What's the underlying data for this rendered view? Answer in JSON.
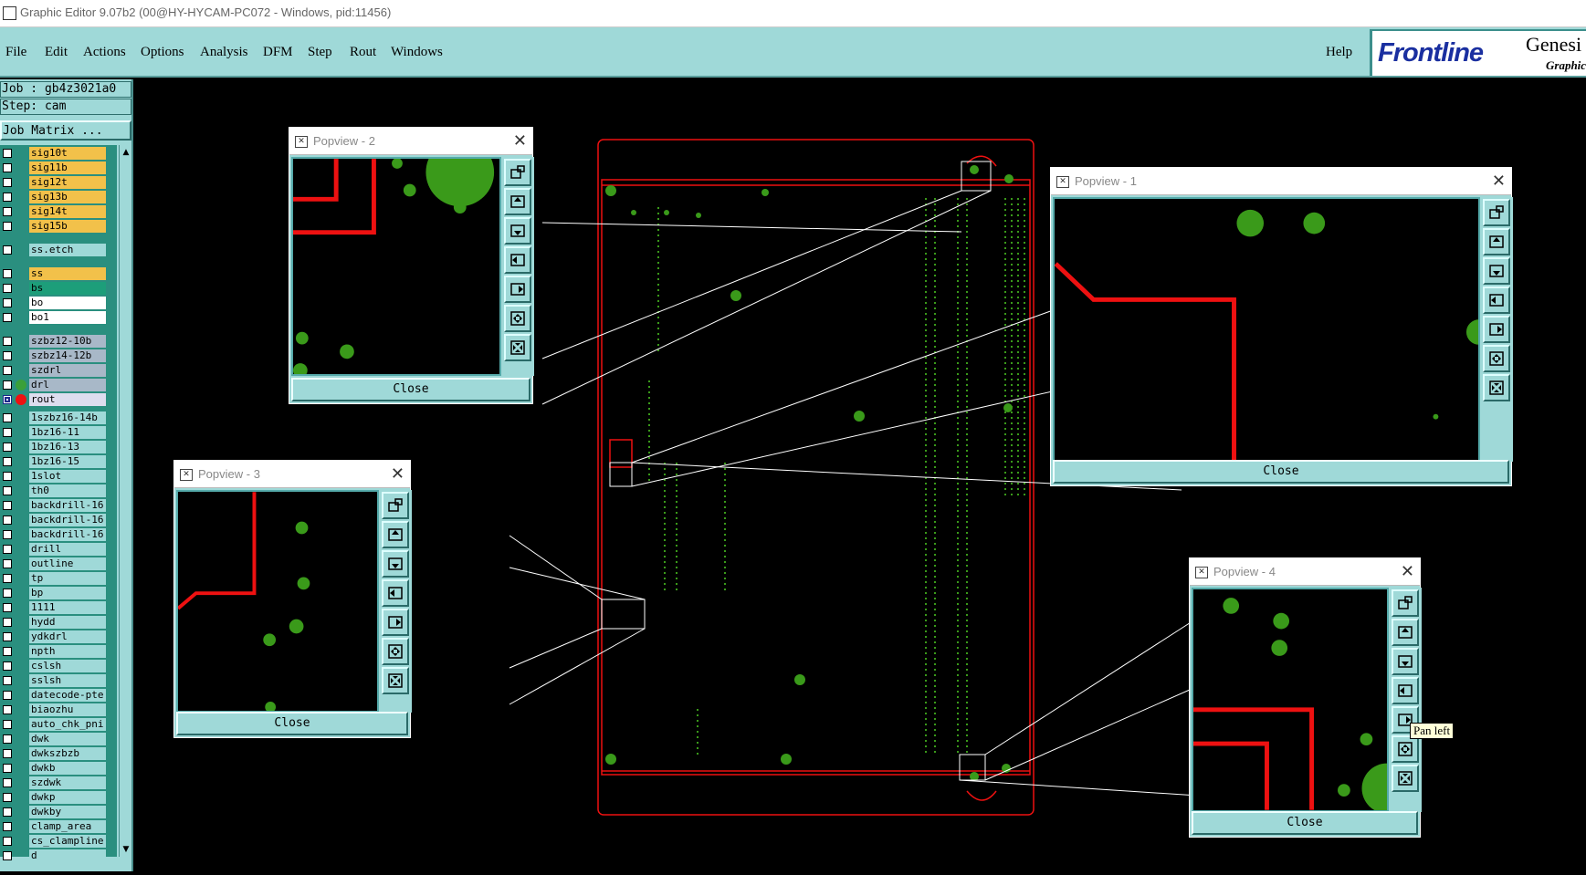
{
  "window": {
    "title": "Graphic Editor 9.07b2 (00@HY-HYCAM-PC072 - Windows, pid:11456)"
  },
  "menu": {
    "items": [
      "File",
      "Edit",
      "Actions",
      "Options",
      "Analysis",
      "DFM",
      "Step",
      "Rout",
      "Windows"
    ],
    "help": "Help"
  },
  "logo": {
    "brand": "Frontline",
    "product": "Genesi",
    "sub": "Graphic"
  },
  "panel": {
    "job": "Job : gb4z3021a0",
    "step": "Step: cam",
    "matrix_button": "Job Matrix ..."
  },
  "layers": [
    {
      "name": "sig10t",
      "color": "yellow"
    },
    {
      "name": "sig11b",
      "color": "yellow"
    },
    {
      "name": "sig12t",
      "color": "yellow"
    },
    {
      "name": "sig13b",
      "color": "yellow"
    },
    {
      "name": "sig14t",
      "color": "yellow"
    },
    {
      "name": "sig15b",
      "color": "yellow"
    },
    {
      "name": "ss.etch",
      "color": "cyan"
    },
    {
      "name": "ss",
      "color": "yellow"
    },
    {
      "name": "bs",
      "color": "green"
    },
    {
      "name": "bo",
      "color": "white"
    },
    {
      "name": "bo1",
      "color": "white"
    },
    {
      "name": "szbz12-10b",
      "color": "grey"
    },
    {
      "name": "szbz14-12b",
      "color": "grey"
    },
    {
      "name": "szdrl",
      "color": "grey"
    },
    {
      "name": "drl",
      "color": "grey",
      "dot": "#3aa03a"
    },
    {
      "name": "rout",
      "color": "rout",
      "dot": "#ee1111",
      "selected": true
    },
    {
      "name": "1szbz16-14b",
      "color": "cyan"
    },
    {
      "name": "1bz16-11",
      "color": "cyan"
    },
    {
      "name": "1bz16-13",
      "color": "cyan"
    },
    {
      "name": "1bz16-15",
      "color": "cyan"
    },
    {
      "name": "1slot",
      "color": "cyan"
    },
    {
      "name": "th0",
      "color": "cyan"
    },
    {
      "name": "backdrill-16",
      "color": "cyan"
    },
    {
      "name": "backdrill-16",
      "color": "cyan"
    },
    {
      "name": "backdrill-16",
      "color": "cyan"
    },
    {
      "name": "drill",
      "color": "cyan"
    },
    {
      "name": "outline",
      "color": "cyan"
    },
    {
      "name": "tp",
      "color": "cyan"
    },
    {
      "name": "bp",
      "color": "cyan"
    },
    {
      "name": "1111",
      "color": "cyan"
    },
    {
      "name": "hydd",
      "color": "cyan"
    },
    {
      "name": "ydkdrl",
      "color": "cyan"
    },
    {
      "name": "npth",
      "color": "cyan"
    },
    {
      "name": "cslsh",
      "color": "cyan"
    },
    {
      "name": "sslsh",
      "color": "cyan"
    },
    {
      "name": "datecode-pte",
      "color": "cyan"
    },
    {
      "name": "biaozhu",
      "color": "cyan"
    },
    {
      "name": "auto_chk_pni",
      "color": "cyan"
    },
    {
      "name": "dwk",
      "color": "cyan"
    },
    {
      "name": "dwkszbzb",
      "color": "cyan"
    },
    {
      "name": "dwkb",
      "color": "cyan"
    },
    {
      "name": "szdwk",
      "color": "cyan"
    },
    {
      "name": "dwkp",
      "color": "cyan"
    },
    {
      "name": "dwkby",
      "color": "cyan"
    },
    {
      "name": "clamp_area",
      "color": "cyan"
    },
    {
      "name": "cs_clampline",
      "color": "cyan"
    },
    {
      "name": "d",
      "color": "cyan"
    }
  ],
  "popviews": [
    {
      "id": "p2",
      "title": "Popview - 2",
      "close": "Close"
    },
    {
      "id": "p1",
      "title": "Popview - 1",
      "close": "Close"
    },
    {
      "id": "p3",
      "title": "Popview - 3",
      "close": "Close"
    },
    {
      "id": "p4",
      "title": "Popview - 4",
      "close": "Close"
    }
  ],
  "tools": [
    "zoom-window",
    "pan-up",
    "pan-down",
    "pan-left",
    "pan-right",
    "zoom-in",
    "zoom-out"
  ],
  "tooltip": "Pan left",
  "colors": {
    "panel": "#9fd9d8",
    "trace": "#ee1111",
    "pad": "#3a9a1a",
    "board_outline": "#ee1111",
    "accent_logo": "#1a2fa0"
  }
}
